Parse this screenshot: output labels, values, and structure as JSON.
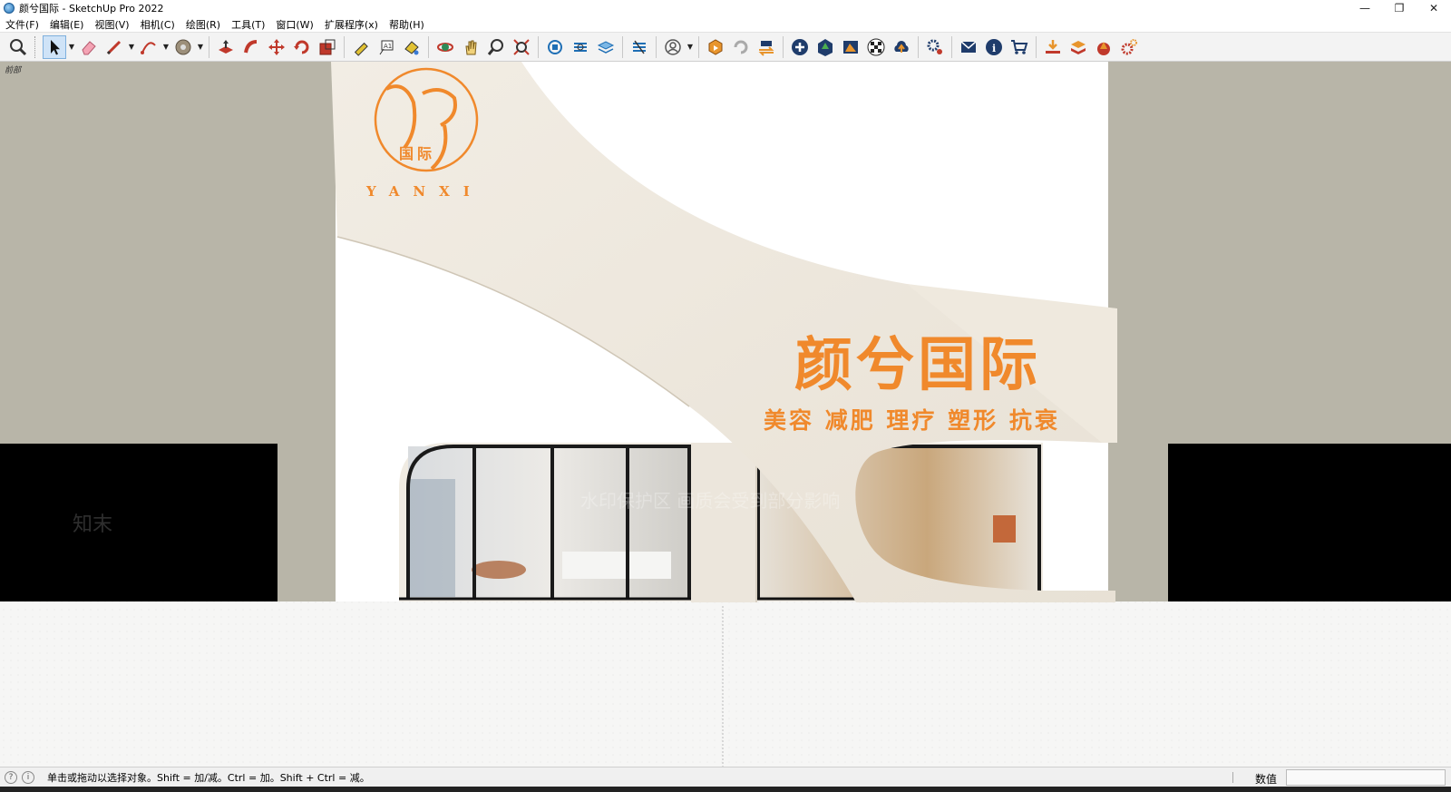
{
  "window": {
    "title": "颜兮国际 - SketchUp Pro 2022",
    "minimize": "—",
    "restore": "❐",
    "close": "✕"
  },
  "menu": [
    "文件(F)",
    "编辑(E)",
    "视图(V)",
    "相机(C)",
    "绘图(R)",
    "工具(T)",
    "窗口(W)",
    "扩展程序(x)",
    "帮助(H)"
  ],
  "toolbar": {
    "icons": [
      "zoom-icon",
      "select-icon",
      "eraser-icon",
      "pencil-icon",
      "arc-icon",
      "tape-icon",
      "push-pull-icon",
      "follow-me-icon",
      "move-icon",
      "rotate-icon",
      "scale-icon",
      "tape-measure-icon",
      "text-icon",
      "paint-icon",
      "orbit-icon",
      "pan-icon",
      "zoom-tool-icon",
      "zoom-extents-icon",
      "warehouse-icon",
      "section-icon",
      "layers-icon",
      "styles-icon",
      "user-icon",
      "extension-icon",
      "refresh-icon",
      "send-icon",
      "add-icon",
      "tree-icon",
      "gallery-icon",
      "checker-icon",
      "upload-icon",
      "settings-icon",
      "mail-icon",
      "info-icon",
      "cart-icon",
      "plugin-a-icon",
      "plugin-b-icon",
      "plugin-c-icon",
      "plugin-d-icon"
    ]
  },
  "scene": {
    "tab_label": "前部",
    "brand_mark": "颜兮",
    "brand_sub": "国际",
    "brand_latin": "YANXI",
    "sign_title": "颜兮国际",
    "sign_services": "美容 减肥 理疗 塑形 抗衰",
    "watermark_text": "知末",
    "watermark_notice": "水印保护区 画质会受到部分影响",
    "colors": {
      "wall": "#b8b5a8",
      "facade": "#efe9de",
      "accent": "#f0892c",
      "glass_frame": "#1a1a1a"
    }
  },
  "status": {
    "hint": "单击或拖动以选择对象。Shift = 加/减。Ctrl = 加。Shift + Ctrl = 减。",
    "vcb_label": "数值",
    "vcb_value": ""
  }
}
